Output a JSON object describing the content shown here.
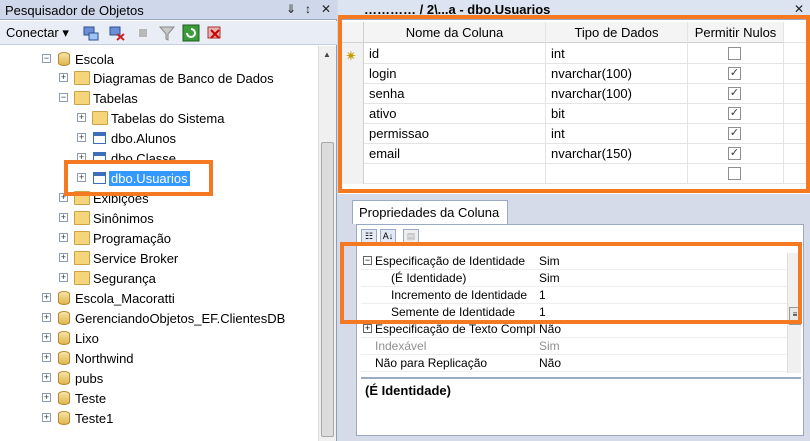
{
  "object_explorer": {
    "title": "Pesquisador de Objetos",
    "pin_glyph": "⇓",
    "autohide_glyph": "↕",
    "close_glyph": "✕",
    "connect_label": "Conectar ▾",
    "toolbar_icons": [
      "connect-icon",
      "disconnect-icon",
      "stop-icon",
      "filter-icon",
      "refresh-icon",
      "remove-icon"
    ],
    "tree": [
      {
        "label": "Escola",
        "expander": "−",
        "icon": "database-icon"
      },
      {
        "label": "Diagramas de Banco de Dados",
        "expander": "+",
        "icon": "folder-icon"
      },
      {
        "label": "Tabelas",
        "expander": "−",
        "icon": "folder-icon"
      },
      {
        "label": "Tabelas do Sistema",
        "expander": "+",
        "icon": "folder-icon"
      },
      {
        "label": "dbo.Alunos",
        "expander": "+",
        "icon": "table-icon"
      },
      {
        "label": "dbo.Classe",
        "expander": "+",
        "icon": "table-icon"
      },
      {
        "label": "dbo.Usuarios",
        "expander": "+",
        "icon": "table-icon",
        "selected": true
      },
      {
        "label": "Exibições",
        "expander": "+",
        "icon": "folder-icon"
      },
      {
        "label": "Sinônimos",
        "expander": "+",
        "icon": "folder-icon"
      },
      {
        "label": "Programação",
        "expander": "+",
        "icon": "folder-icon"
      },
      {
        "label": "Service Broker",
        "expander": "+",
        "icon": "folder-icon"
      },
      {
        "label": "Segurança",
        "expander": "+",
        "icon": "folder-icon"
      },
      {
        "label": "Escola_Macoratti",
        "expander": "+",
        "icon": "database-icon"
      },
      {
        "label": "GerenciandoObjetos_EF.ClientesDB",
        "expander": "+",
        "icon": "database-icon"
      },
      {
        "label": "Lixo",
        "expander": "+",
        "icon": "database-icon"
      },
      {
        "label": "Northwind",
        "expander": "+",
        "icon": "database-icon"
      },
      {
        "label": "pubs",
        "expander": "+",
        "icon": "database-icon"
      },
      {
        "label": "Teste",
        "expander": "+",
        "icon": "database-icon"
      },
      {
        "label": "Teste1",
        "expander": "+",
        "icon": "database-icon"
      }
    ]
  },
  "designer": {
    "tab_title": "………… / 2\\...a - dbo.Usuarios",
    "close_glyph": "✕",
    "columns_header": [
      "Nome da Coluna",
      "Tipo de Dados",
      "Permitir Nulos"
    ],
    "rows": [
      {
        "name": "id",
        "type": "int",
        "nullable": false,
        "key": true
      },
      {
        "name": "login",
        "type": "nvarchar(100)",
        "nullable": true,
        "key": false
      },
      {
        "name": "senha",
        "type": "nvarchar(100)",
        "nullable": true,
        "key": false
      },
      {
        "name": "ativo",
        "type": "bit",
        "nullable": true,
        "key": false
      },
      {
        "name": "permissao",
        "type": "int",
        "nullable": true,
        "key": false
      },
      {
        "name": "email",
        "type": "nvarchar(150)",
        "nullable": true,
        "key": false
      },
      {
        "name": "",
        "type": "",
        "nullable": false,
        "key": false
      }
    ],
    "key_glyph": "✴",
    "check_glyph": "✓"
  },
  "column_properties": {
    "tab_label": "Propriedades da Coluna",
    "toolbar": [
      "☷",
      "A↓",
      "▤"
    ],
    "rows": [
      {
        "name": "Especificação de Identidade",
        "value": "Sim",
        "expander": "−",
        "indent": false,
        "disabled": false
      },
      {
        "name": "(É Identidade)",
        "value": "Sim",
        "expander": "",
        "indent": true,
        "disabled": false
      },
      {
        "name": "Incremento de Identidade",
        "value": "1",
        "expander": "",
        "indent": true,
        "disabled": false
      },
      {
        "name": "Semente de Identidade",
        "value": "1",
        "expander": "",
        "indent": true,
        "disabled": false
      },
      {
        "name": "Especificação de Texto Completo",
        "value": "Não",
        "expander": "+",
        "indent": false,
        "disabled": false
      },
      {
        "name": "Indexável",
        "value": "Sim",
        "expander": "",
        "indent": false,
        "disabled": true
      },
      {
        "name": "Não para Replicação",
        "value": "Não",
        "expander": "",
        "indent": false,
        "disabled": false
      }
    ],
    "scroll_grip": "≡",
    "description": "(É Identidade)"
  },
  "colors": {
    "highlight": "#f47920",
    "selection": "#3399ff"
  }
}
